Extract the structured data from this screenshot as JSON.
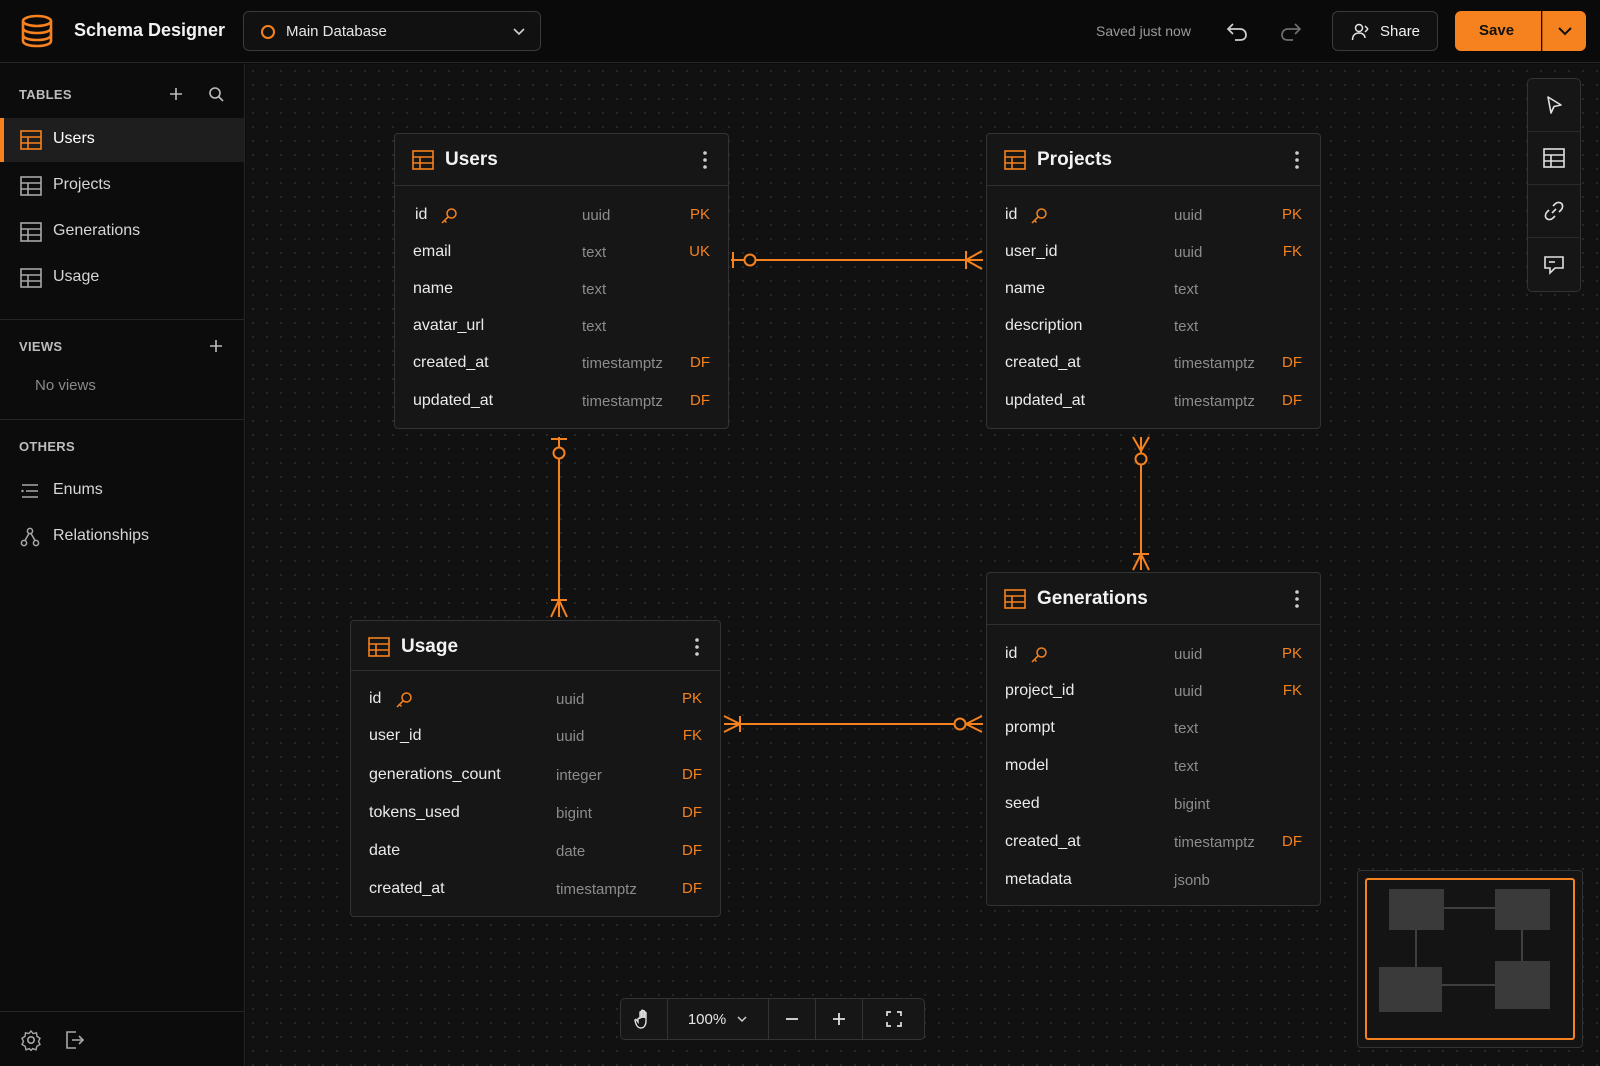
{
  "app": {
    "title": "Schema Designer"
  },
  "toolbar": {
    "database": "Main Database",
    "saved_status": "Saved just now",
    "share_label": "Share",
    "save_label": "Save",
    "accent_color": "#f5821f"
  },
  "sidebar": {
    "tables_title": "TABLES",
    "tables": [
      {
        "label": "Users",
        "active": true
      },
      {
        "label": "Projects",
        "active": false
      },
      {
        "label": "Generations",
        "active": false
      },
      {
        "label": "Usage",
        "active": false
      }
    ],
    "views_title": "VIEWS",
    "no_views": "No views",
    "others_title": "OTHERS",
    "others": [
      {
        "label": "Enums",
        "icon": "list-icon"
      },
      {
        "label": "Relationships",
        "icon": "relationships-icon"
      }
    ]
  },
  "tables": {
    "users": {
      "name": "Users",
      "columns": [
        {
          "name": "id",
          "type": "uuid",
          "constraint": "PK",
          "key": true
        },
        {
          "name": "email",
          "type": "text",
          "constraint": "UK"
        },
        {
          "name": "name",
          "type": "text",
          "constraint": ""
        },
        {
          "name": "avatar_url",
          "type": "text",
          "constraint": ""
        },
        {
          "name": "created_at",
          "type": "timestamptz",
          "constraint": "DF"
        },
        {
          "name": "updated_at",
          "type": "timestamptz",
          "constraint": "DF"
        }
      ]
    },
    "projects": {
      "name": "Projects",
      "columns": [
        {
          "name": "id",
          "type": "uuid",
          "constraint": "PK",
          "key": true
        },
        {
          "name": "user_id",
          "type": "uuid",
          "constraint": "FK"
        },
        {
          "name": "name",
          "type": "text",
          "constraint": ""
        },
        {
          "name": "description",
          "type": "text",
          "constraint": ""
        },
        {
          "name": "created_at",
          "type": "timestamptz",
          "constraint": "DF"
        },
        {
          "name": "updated_at",
          "type": "timestamptz",
          "constraint": "DF"
        }
      ]
    },
    "usage": {
      "name": "Usage",
      "columns": [
        {
          "name": "id",
          "type": "uuid",
          "constraint": "PK",
          "key": true
        },
        {
          "name": "user_id",
          "type": "uuid",
          "constraint": "FK"
        },
        {
          "name": "generations_count",
          "type": "integer",
          "constraint": "DF"
        },
        {
          "name": "tokens_used",
          "type": "bigint",
          "constraint": "DF"
        },
        {
          "name": "date",
          "type": "date",
          "constraint": "DF"
        },
        {
          "name": "created_at",
          "type": "timestamptz",
          "constraint": "DF"
        }
      ]
    },
    "generations": {
      "name": "Generations",
      "columns": [
        {
          "name": "id",
          "type": "uuid",
          "constraint": "PK",
          "key": true
        },
        {
          "name": "project_id",
          "type": "uuid",
          "constraint": "FK"
        },
        {
          "name": "prompt",
          "type": "text",
          "constraint": ""
        },
        {
          "name": "model",
          "type": "text",
          "constraint": ""
        },
        {
          "name": "seed",
          "type": "bigint",
          "constraint": ""
        },
        {
          "name": "created_at",
          "type": "timestamptz",
          "constraint": "DF"
        },
        {
          "name": "metadata",
          "type": "jsonb",
          "constraint": ""
        }
      ]
    }
  },
  "zoom": {
    "value": "100%"
  }
}
